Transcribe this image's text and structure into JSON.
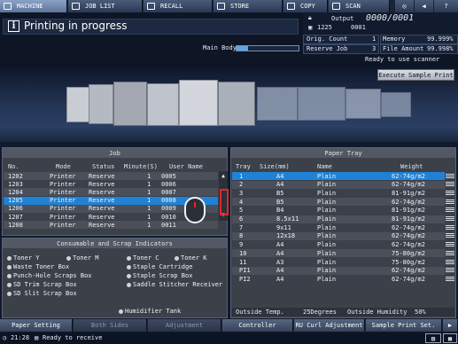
{
  "tabs": [
    {
      "label": "MACHINE",
      "active": true
    },
    {
      "label": "JOB LIST",
      "active": false
    },
    {
      "label": "RECALL",
      "active": false
    },
    {
      "label": "STORE",
      "active": false
    },
    {
      "label": "COPY",
      "active": false
    },
    {
      "label": "SCAN",
      "active": false
    }
  ],
  "header": {
    "title": "Printing in progress",
    "output_label": "Output",
    "output_value": "0000/0001",
    "job_count": "1225",
    "job_sub": "0001",
    "main_body_label": "Main Body",
    "orig_count_label": "Orig. Count",
    "orig_count_value": "1",
    "memory_label": "Memory",
    "memory_value": "99.999%",
    "reserve_job_label": "Reserve Job",
    "reserve_job_value": "3",
    "file_amount_label": "File Amount",
    "file_amount_value": "99.998%",
    "scanner_status": "Ready to use scanner"
  },
  "execute_button": "Execute Sample Print",
  "job_panel": {
    "title": "Job",
    "columns": [
      "No.",
      "Mode",
      "Status",
      "Minute(S)",
      "User Name"
    ],
    "rows": [
      {
        "no": "1202",
        "mode": "Printer",
        "status": "Reserve",
        "min": "1",
        "user": "0005"
      },
      {
        "no": "1203",
        "mode": "Printer",
        "status": "Reserve",
        "min": "1",
        "user": "0006"
      },
      {
        "no": "1204",
        "mode": "Printer",
        "status": "Reserve",
        "min": "1",
        "user": "0007"
      },
      {
        "no": "1205",
        "mode": "Printer",
        "status": "Reserve",
        "min": "1",
        "user": "0008"
      },
      {
        "no": "1206",
        "mode": "Printer",
        "status": "Reserve",
        "min": "1",
        "user": "0009"
      },
      {
        "no": "1207",
        "mode": "Printer",
        "status": "Reserve",
        "min": "1",
        "user": "0010"
      },
      {
        "no": "1208",
        "mode": "Printer",
        "status": "Reserve",
        "min": "1",
        "user": "0011"
      }
    ],
    "selected_index": 3
  },
  "consumables": {
    "title": "Consumable and Scrap Indicators",
    "items": [
      "Toner Y",
      "Toner M",
      "Toner C",
      "Toner K",
      "Waste Toner Box",
      "Staple Cartridge",
      "Punch-Hole Scraps Box",
      "Staple Scrap Box",
      "SD Trim Scrap Box",
      "Saddle Stitcher Receiver",
      "SD Slit Scrap Box",
      "Humidifier Tank"
    ]
  },
  "paper_tray": {
    "title": "Paper Tray",
    "columns": [
      "Tray",
      "Size(mm)",
      "Name",
      "Weight"
    ],
    "rows": [
      {
        "tray": "1",
        "size": "A4",
        "name": "Plain",
        "weight": "62-74g/m2"
      },
      {
        "tray": "2",
        "size": "A4",
        "name": "Plain",
        "weight": "62-74g/m2"
      },
      {
        "tray": "3",
        "size": "B5",
        "name": "Plain",
        "weight": "81-91g/m2"
      },
      {
        "tray": "4",
        "size": "B5",
        "name": "Plain",
        "weight": "62-74g/m2"
      },
      {
        "tray": "5",
        "size": "B4",
        "name": "Plain",
        "weight": "81-91g/m2"
      },
      {
        "tray": "6",
        "size": "8.5x11",
        "name": "Plain",
        "weight": "81-91g/m2"
      },
      {
        "tray": "7",
        "size": "9x11",
        "name": "Plain",
        "weight": "62-74g/m2"
      },
      {
        "tray": "8",
        "size": "12x18",
        "name": "Plain",
        "weight": "62-74g/m2"
      },
      {
        "tray": "9",
        "size": "A4",
        "name": "Plain",
        "weight": "62-74g/m2"
      },
      {
        "tray": "10",
        "size": "A4",
        "name": "Plain",
        "weight": "75-80g/m2"
      },
      {
        "tray": "11",
        "size": "A3",
        "name": "Plain",
        "weight": "75-80g/m2"
      },
      {
        "tray": "PI1",
        "size": "A4",
        "name": "Plain",
        "weight": "62-74g/m2"
      },
      {
        "tray": "PI2",
        "size": "A4",
        "name": "Plain",
        "weight": "62-74g/m2"
      }
    ],
    "selected_index": 0,
    "outside_temp_label": "Outside Temp.",
    "outside_temp_value": "25Degrees",
    "outside_humidity_label": "Outside Humidity",
    "outside_humidity_value": "50%"
  },
  "footer": {
    "buttons": [
      {
        "label": "Paper Setting",
        "enabled": true
      },
      {
        "label": "Both Sides",
        "enabled": false
      },
      {
        "label": "Adjustment",
        "enabled": false
      },
      {
        "label": "Controller",
        "enabled": true
      },
      {
        "label": "RU Curl Adjustment",
        "enabled": true
      },
      {
        "label": "Sample Print Set.",
        "enabled": true
      }
    ]
  },
  "status_bar": {
    "time": "21:28",
    "message": "Ready to receive"
  },
  "colors": {
    "accent": "#1f82d6",
    "panel": "#3c4048",
    "background": "#0f1a2e"
  }
}
